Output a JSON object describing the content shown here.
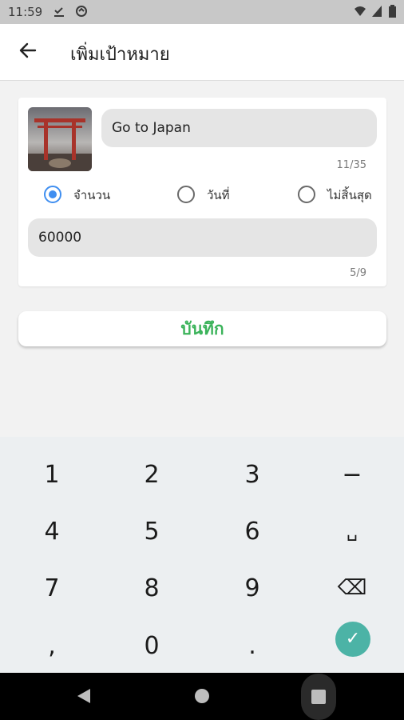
{
  "status_bar": {
    "time": "11:59"
  },
  "app_bar": {
    "title": "เพิ่มเป้าหมาย"
  },
  "form": {
    "goal_name": "Go to Japan",
    "goal_name_counter": "11/35",
    "radio_options": [
      {
        "label": "จำนวน",
        "selected": true
      },
      {
        "label": "วันที่",
        "selected": false
      },
      {
        "label": "ไม่สิ้นสุด",
        "selected": false
      }
    ],
    "amount": "60000",
    "amount_counter": "5/9"
  },
  "save_button": {
    "label": "บันทึก"
  },
  "keyboard": {
    "keys": [
      "1",
      "2",
      "3",
      "−",
      "4",
      "5",
      "6",
      "␣",
      "7",
      "8",
      "9",
      "⌫",
      ",",
      "0",
      ".",
      "✓"
    ]
  },
  "colors": {
    "accent_blue": "#3f8ef0",
    "save_green": "#3bb35a",
    "done_teal": "#4cb3a6"
  }
}
